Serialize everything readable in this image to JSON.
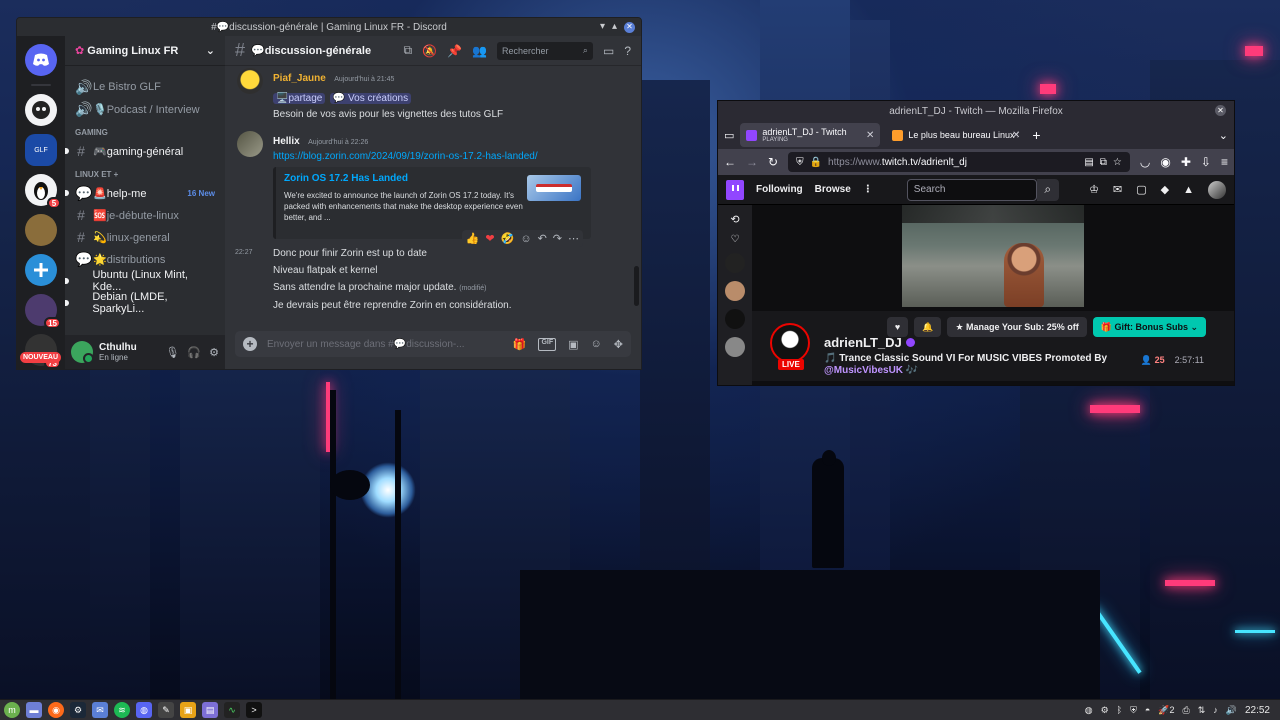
{
  "discord": {
    "window_title": "#💬discussion-générale | Gaming Linux FR - Discord",
    "server_name": "Gaming Linux FR",
    "guild_badges": [
      "5",
      "15",
      "73"
    ],
    "nouveau_label": "NOUVEAU",
    "channels_top": [
      {
        "label": "Le Bistro GLF"
      },
      {
        "label": "🎙️Podcast / Interview"
      }
    ],
    "category_gaming": "GAMING",
    "channels_gaming": [
      {
        "label": "🎮gaming-général"
      }
    ],
    "category_linux": "LINUX ET +",
    "channels_linux": [
      {
        "label": "🚨help-me",
        "new": "16 New"
      },
      {
        "label": "🆘je-débute-linux"
      },
      {
        "label": "💫linux-general"
      },
      {
        "label": "🌟distributions"
      },
      {
        "label": "Ubuntu (Linux Mint, Kde..."
      },
      {
        "label": "Debian (LMDE, SparkyLi..."
      }
    ],
    "user": {
      "name": "Cthulhu",
      "status": "En ligne"
    },
    "channel_title": "💬discussion-générale",
    "search_placeholder": "Rechercher",
    "messages": [
      {
        "author": "Piaf_Jaune",
        "time": "Aujourd'hui à 21:45",
        "tag1": "🖥️partage",
        "tag2": "💬 Vos créations",
        "text": "Besoin de vos avis pour les vignettes des tutos GLF"
      },
      {
        "author": "Hellix",
        "time": "Aujourd'hui à 22:26",
        "link": "https://blog.zorin.com/2024/09/19/zorin-os-17.2-has-landed/",
        "embed_title": "Zorin OS 17.2 Has Landed",
        "embed_desc": "We're excited to announce the launch of Zorin OS 17.2 today. It's packed with enhancements that make the desktop experience even better, and ..."
      }
    ],
    "continuation": {
      "stamp": "22:27",
      "lines": [
        "Donc pour finir Zorin est up to date",
        "Niveau flatpak et kernel",
        "Sans attendre la prochaine major update.",
        "Je devrais peut être reprendre Zorin en considération."
      ],
      "edited": "(modifié)"
    },
    "composer_placeholder": "Envoyer un message dans #💬discussion-...",
    "gif_label": "GIF"
  },
  "firefox": {
    "window_title": "adrienLT_DJ - Twitch — Mozilla Firefox",
    "tabs": [
      {
        "title": "adrienLT_DJ - Twitch",
        "sub": "PLAYING"
      },
      {
        "title": "Le plus beau bureau Linux !"
      }
    ],
    "url_dim": "https://www.",
    "url_main": "twitch.tv/adrienlt_dj"
  },
  "twitch": {
    "nav_following": "Following",
    "nav_browse": "Browse",
    "search_placeholder": "Search",
    "streamer": "adrienLT_DJ",
    "live": "LIVE",
    "title_pre": "🎵 Trance Classic Sound VI For MUSIC VIBES Promoted By ",
    "title_mention": "@MusicVibesUK",
    "title_post": " 🎶",
    "viewers": "25",
    "uptime": "2:57:11",
    "btn_sub": "Manage Your Sub: 25% off",
    "btn_gift": "Gift: Bonus Subs"
  },
  "taskbar": {
    "clock": "22:52",
    "tray_count": "2"
  }
}
